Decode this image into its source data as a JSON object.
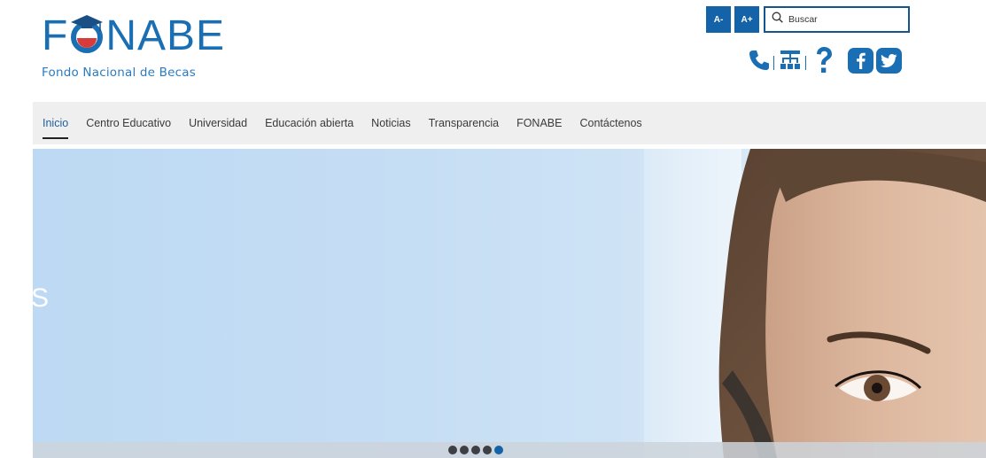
{
  "brand": {
    "name_prefix": "F",
    "name_suffix": "NABE",
    "subtitle": "Fondo Nacional de Becas",
    "color_primary": "#1a6fb4",
    "color_accent": "#d93a3a"
  },
  "toolbar": {
    "font_decrease": "A-",
    "font_increase": "A+",
    "search_placeholder": "Buscar"
  },
  "quick_icons": [
    "phone-icon",
    "sitemap-icon",
    "help-icon",
    "facebook-icon",
    "twitter-icon"
  ],
  "nav": {
    "items": [
      {
        "label": "Inicio",
        "active": true
      },
      {
        "label": "Centro Educativo",
        "active": false
      },
      {
        "label": "Universidad",
        "active": false
      },
      {
        "label": "Educación abierta",
        "active": false
      },
      {
        "label": "Noticias",
        "active": false
      },
      {
        "label": "Transparencia",
        "active": false
      },
      {
        "label": "FONABE",
        "active": false
      },
      {
        "label": "Contáctenos",
        "active": false
      }
    ]
  },
  "hero": {
    "partial_text": "S",
    "slides_total": 5,
    "active_slide": 5
  }
}
